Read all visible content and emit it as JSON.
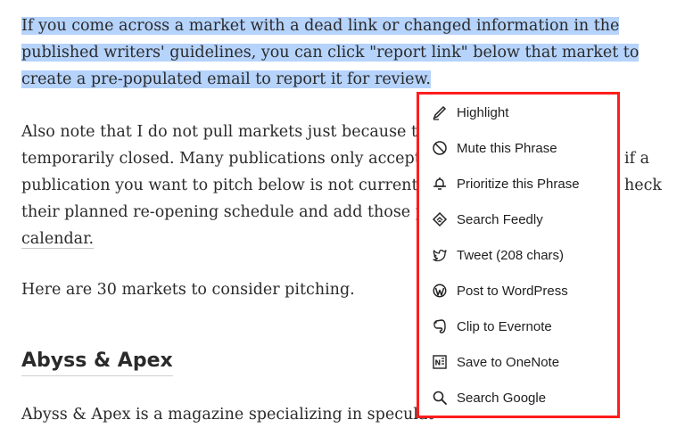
{
  "article": {
    "p1_line1": "If you come across a market with a dead link or changed information in the",
    "p1_line2": "published writers' guidelines, you can click \"report link\" below that market to",
    "p1_line3": "create a pre-populated email to report it for review.",
    "p2_line1": "Also note that I do not pull markets just because they",
    "p2_line1_end": "",
    "p2_line2": "temporarily closed. Many publications only accept",
    "p2_line2_end": "if a",
    "p2_line3": "publication you want to pitch below is not currently",
    "p2_line3_end": "heck",
    "p2_line4": "their planned re-opening schedule and add those p",
    "p2_line5": "calendar.",
    "p3": "Here are 30 markets to consider pitching.",
    "heading": "Abyss & Apex",
    "p4": "Abyss & Apex is a magazine specializing in speculat"
  },
  "menu": {
    "items": [
      {
        "label": "Highlight",
        "icon": "highlighter-icon"
      },
      {
        "label": "Mute this Phrase",
        "icon": "mute-icon"
      },
      {
        "label": "Prioritize this Phrase",
        "icon": "prioritize-icon"
      },
      {
        "label": "Search Feedly",
        "icon": "feedly-icon"
      },
      {
        "label": "Tweet (208 chars)",
        "icon": "twitter-icon"
      },
      {
        "label": "Post to WordPress",
        "icon": "wordpress-icon"
      },
      {
        "label": "Clip to Evernote",
        "icon": "evernote-icon"
      },
      {
        "label": "Save to OneNote",
        "icon": "onenote-icon"
      },
      {
        "label": "Search Google",
        "icon": "search-icon"
      }
    ],
    "border_color": "#ff1d1d"
  },
  "colors": {
    "selection": "#b5d3fb",
    "text": "#2b2b2b"
  }
}
